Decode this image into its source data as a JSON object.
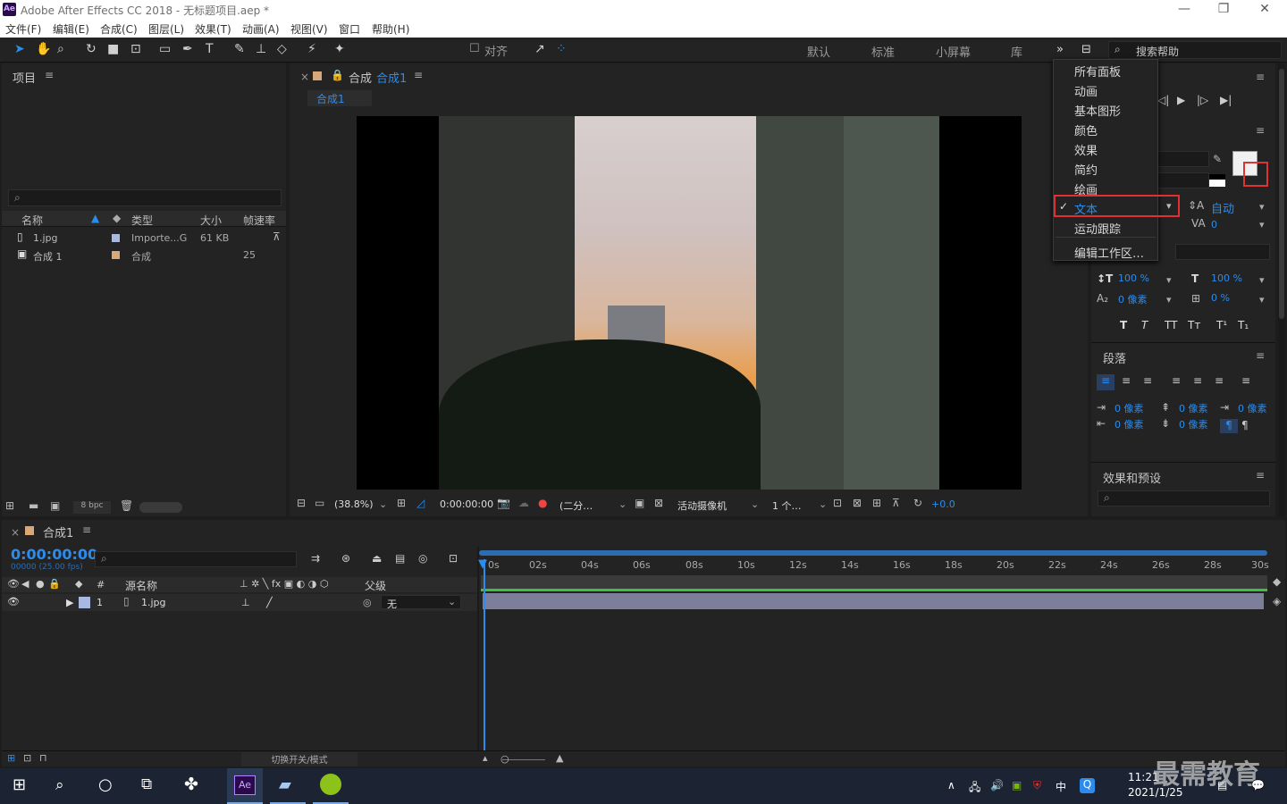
{
  "window": {
    "title": "Adobe After Effects CC 2018 - 无标题项目.aep *",
    "logo": "Ae"
  },
  "menu": [
    "文件(F)",
    "编辑(E)",
    "合成(C)",
    "图层(L)",
    "效果(T)",
    "动画(A)",
    "视图(V)",
    "窗口",
    "帮助(H)"
  ],
  "toolbar": {
    "align": "对齐",
    "workspaces": [
      "默认",
      "标准",
      "小屏幕",
      "库"
    ],
    "search_placeholder": "搜索帮助"
  },
  "project": {
    "title": "项目",
    "cols": [
      "名称",
      "类型",
      "大小",
      "帧速率"
    ],
    "rows": [
      {
        "name": "1.jpg",
        "type": "Importe...G",
        "size": "61 KB",
        "fps": ""
      },
      {
        "name": "合成 1",
        "type": "合成",
        "size": "",
        "fps": "25"
      }
    ],
    "bpc": "8 bpc"
  },
  "comp": {
    "tab_prefix": "合成",
    "tab_name": "合成1",
    "sub_tab": "合成1",
    "zoom": "(38.8%)",
    "time": "0:00:00:00",
    "resolution": "(二分…",
    "camera": "活动摄像机",
    "views": "1 个…",
    "exposure": "+0.0"
  },
  "dropdown": {
    "items": [
      "所有面板",
      "动画",
      "基本图形",
      "颜色",
      "效果",
      "简约",
      "绘画",
      "文本",
      "运动跟踪",
      "编辑工作区…"
    ],
    "checked": "文本"
  },
  "character": {
    "leading": "自动",
    "kerning": "0",
    "vscale": "100 %",
    "hscale": "100 %",
    "baseline": "0 像素",
    "tsume": "0 %",
    "styles": [
      "T",
      "T",
      "TT",
      "Tт",
      "T¹",
      "T₁"
    ]
  },
  "paragraph": {
    "title": "段落",
    "indent": [
      "0 像素",
      "0 像素",
      "0 像素",
      "0 像素",
      "0 像素"
    ]
  },
  "effects": {
    "title": "效果和预设"
  },
  "timeline": {
    "tab": "合成1",
    "timecode": "0:00:00:00",
    "fps": "00000 (25.00 fps)",
    "cols": [
      "#",
      "源名称",
      "父级"
    ],
    "layer": {
      "num": "1",
      "name": "1.jpg",
      "parent": "无"
    },
    "ticks": [
      "0s",
      "02s",
      "04s",
      "06s",
      "08s",
      "10s",
      "12s",
      "14s",
      "16s",
      "18s",
      "20s",
      "22s",
      "24s",
      "26s",
      "28s",
      "30s"
    ],
    "footer": "切换开关/模式"
  },
  "taskbar": {
    "time": "11:21",
    "date": "2021/1/25",
    "ime": "中",
    "watermark": "最需教育"
  }
}
